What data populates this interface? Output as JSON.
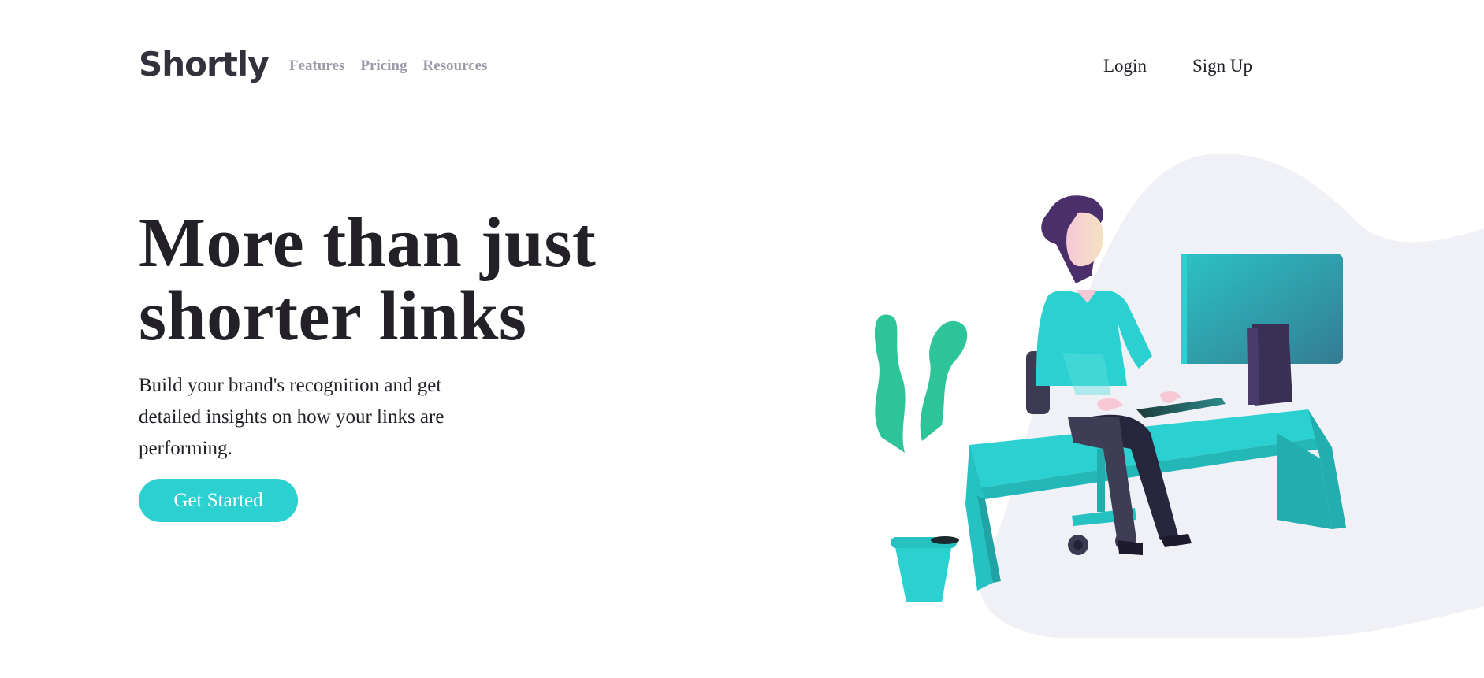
{
  "brand": {
    "name": "Shortly"
  },
  "nav": {
    "links": [
      "Features",
      "Pricing",
      "Resources"
    ],
    "login_label": "Login",
    "signup_label": "Sign Up"
  },
  "hero": {
    "title_line1": "More than just",
    "title_line2": "shorter links",
    "subtitle": "Build your brand's recognition and get detailed insights on how your links are performing.",
    "cta_label": "Get Started"
  },
  "colors": {
    "accent": "#2bd0d0",
    "dark_text": "#232127",
    "nav_gray": "#9e9aa8",
    "blob": "#f0f1f6",
    "plant_green": "#2ec499",
    "hair_purple": "#4b2f6b"
  },
  "illustration": {
    "name": "person-working-at-desk-illustration"
  }
}
